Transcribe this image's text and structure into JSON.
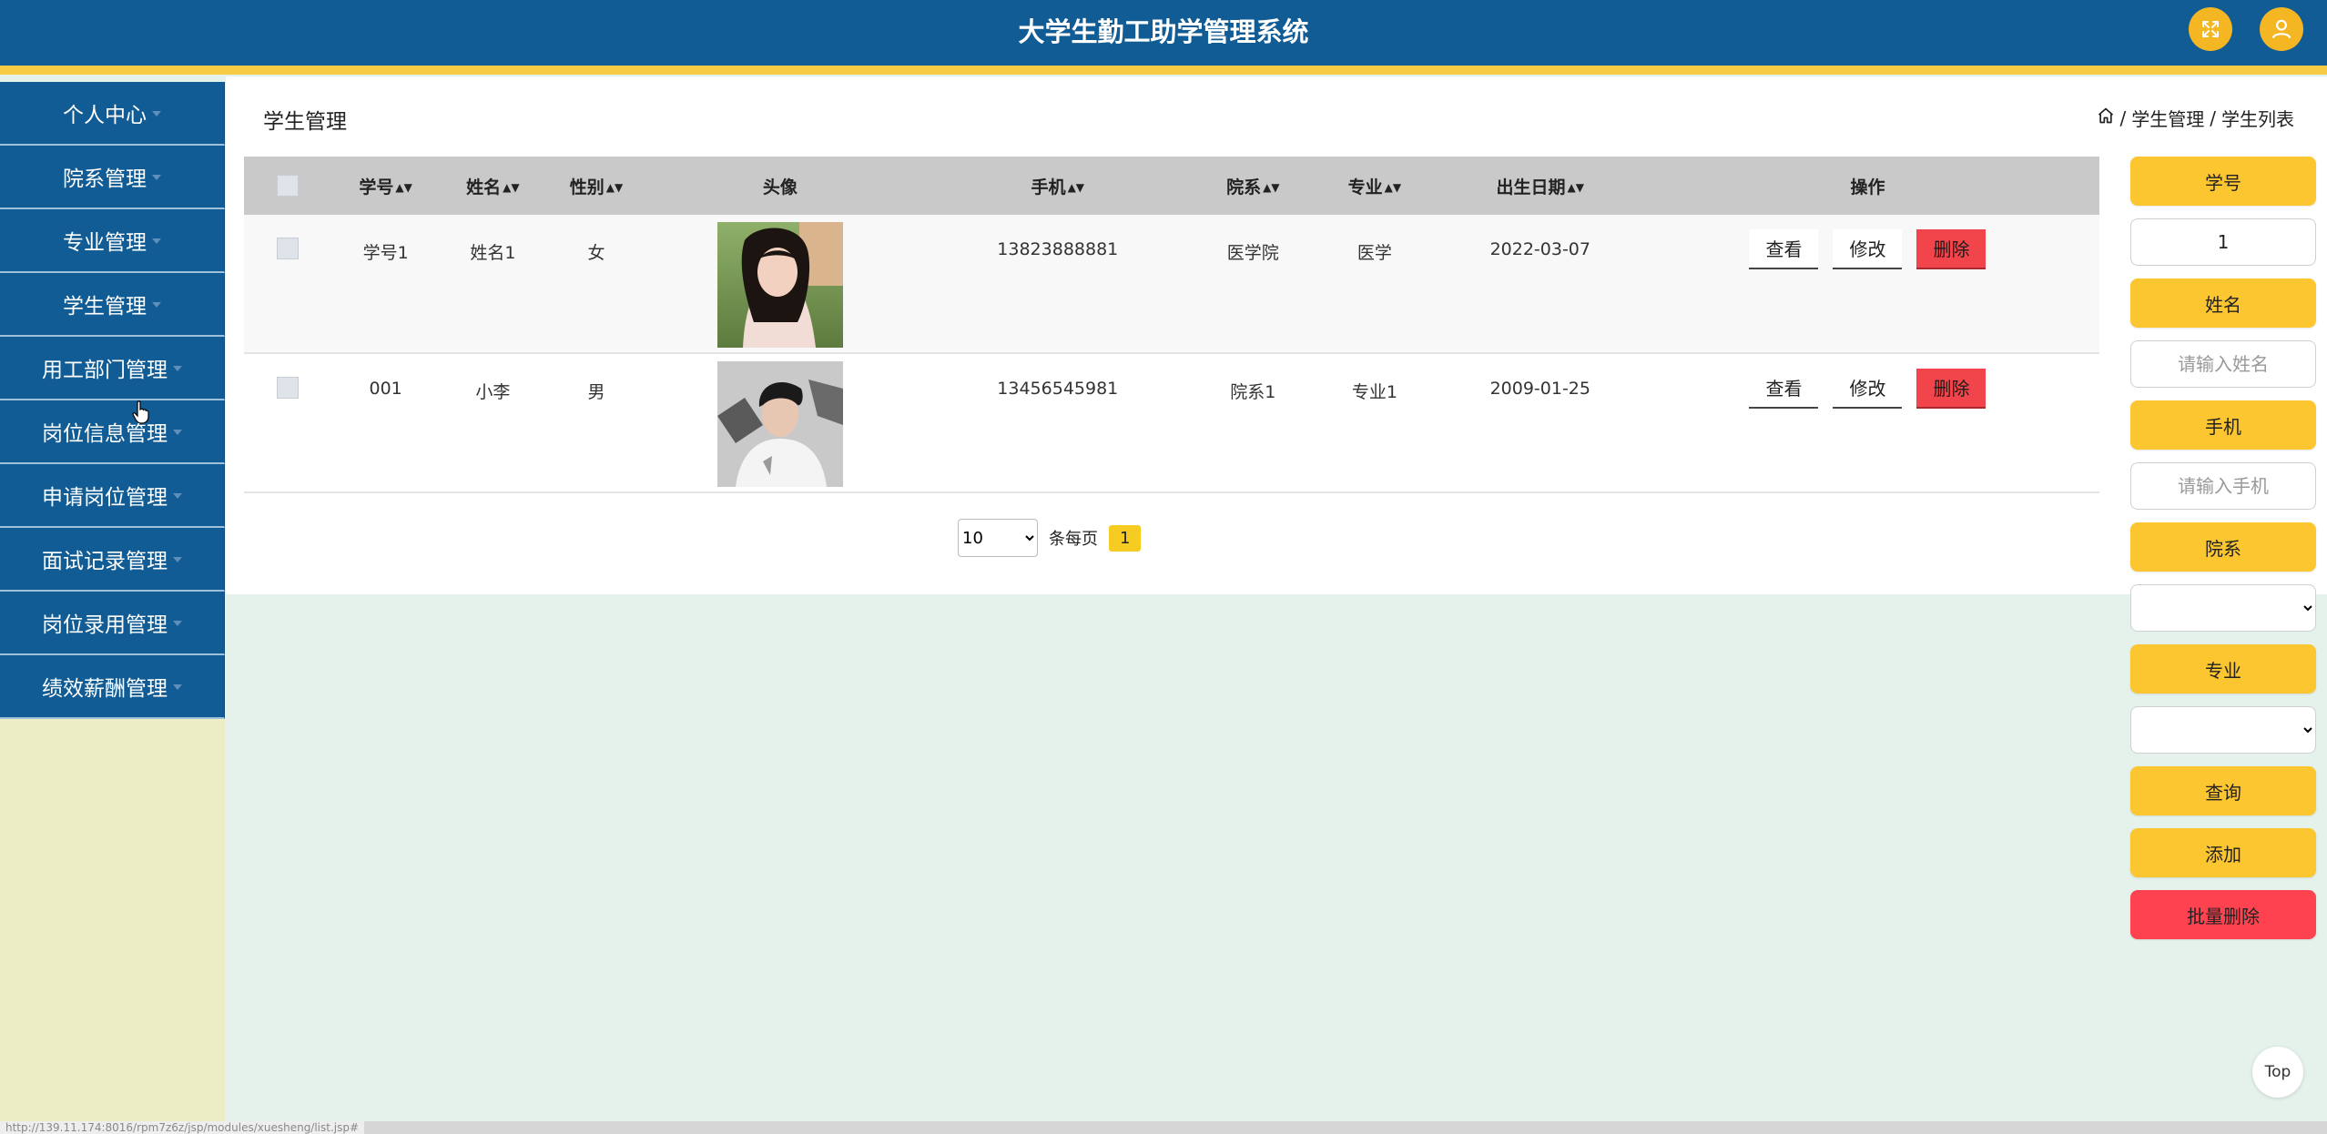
{
  "header": {
    "title": "大学生勤工助学管理系统"
  },
  "sidebar": {
    "items": [
      {
        "label": "个人中心"
      },
      {
        "label": "院系管理"
      },
      {
        "label": "专业管理"
      },
      {
        "label": "学生管理"
      },
      {
        "label": "用工部门管理"
      },
      {
        "label": "岗位信息管理"
      },
      {
        "label": "申请岗位管理"
      },
      {
        "label": "面试记录管理"
      },
      {
        "label": "岗位录用管理"
      },
      {
        "label": "绩效薪酬管理"
      }
    ]
  },
  "page": {
    "title": "学生管理",
    "breadcrumb": [
      "学生管理",
      "学生列表"
    ]
  },
  "table": {
    "headers": [
      "学号",
      "姓名",
      "性别",
      "头像",
      "手机",
      "院系",
      "专业",
      "出生日期",
      "操作"
    ],
    "rows": [
      {
        "xuehao": "学号1",
        "xingming": "姓名1",
        "xingbie": "女",
        "shouji": "13823888881",
        "yuanxi": "医学院",
        "zhuanye": "医学",
        "chusheng": "2022-03-07"
      },
      {
        "xuehao": "001",
        "xingming": "小李",
        "xingbie": "男",
        "shouji": "13456545981",
        "yuanxi": "院系1",
        "zhuanye": "专业1",
        "chusheng": "2009-01-25"
      }
    ],
    "actions": {
      "view": "查看",
      "edit": "修改",
      "delete": "删除"
    }
  },
  "pager": {
    "page_size": "10",
    "per_page_label": "条每页",
    "current_page": "1"
  },
  "filter": {
    "xuehao_label": "学号",
    "xuehao_value": "1",
    "xingming_label": "姓名",
    "xingming_placeholder": "请输入姓名",
    "shouji_label": "手机",
    "shouji_placeholder": "请输入手机",
    "yuanxi_label": "院系",
    "zhuanye_label": "专业",
    "search_label": "查询",
    "add_label": "添加",
    "batch_delete_label": "批量删除"
  },
  "misc": {
    "top_label": "Top",
    "status_url": "http://139.11.174:8016/rpm7z6z/jsp/modules/xuesheng/list.jsp#"
  },
  "colors": {
    "header_bg": "#115c94",
    "accent_yellow": "#fcc630",
    "danger_red": "#f2454b"
  }
}
